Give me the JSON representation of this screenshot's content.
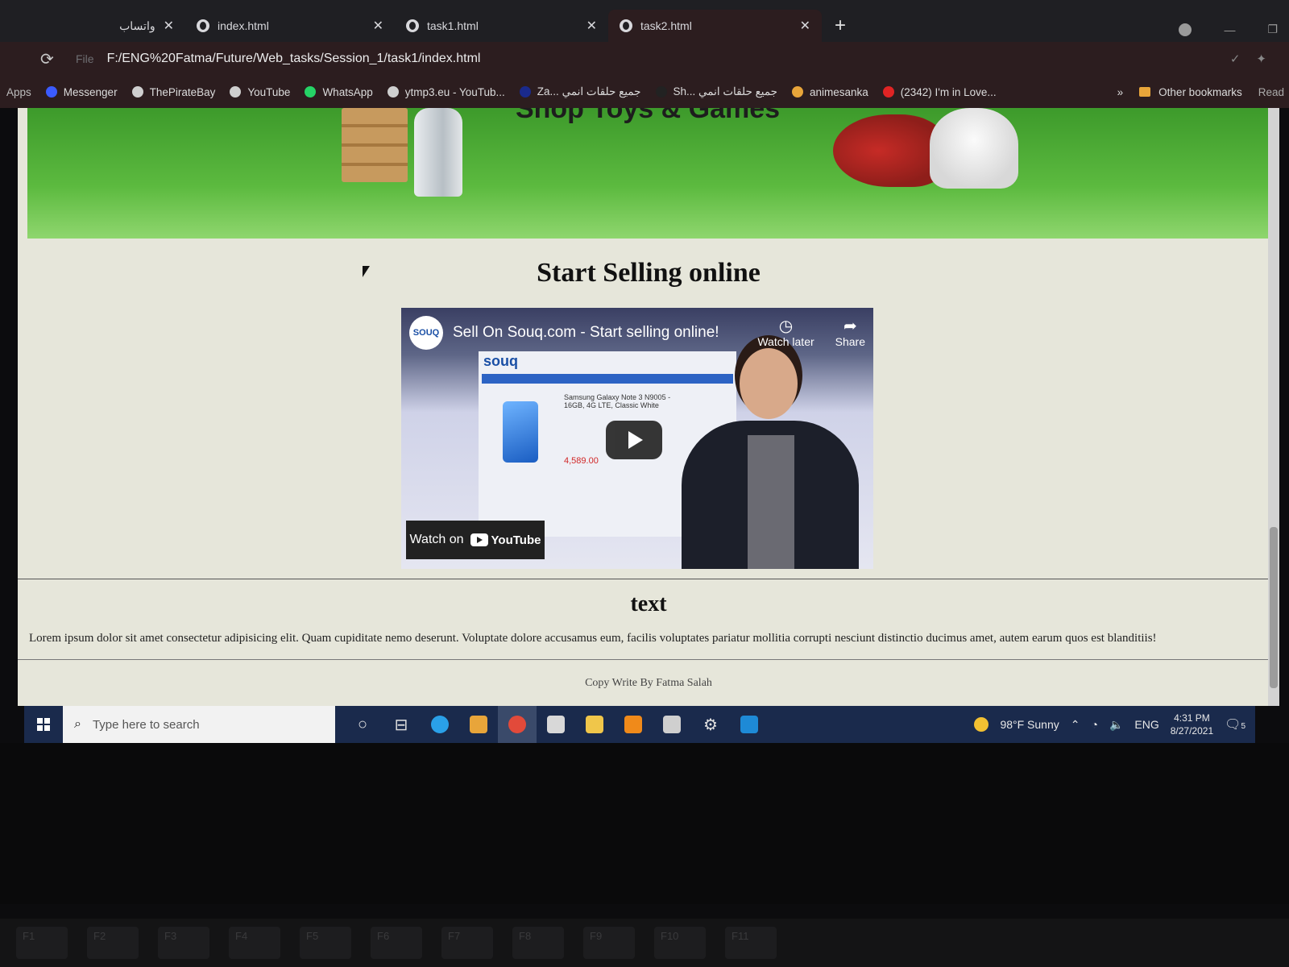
{
  "browser": {
    "tabs": [
      {
        "label": "واتساب",
        "active": false
      },
      {
        "label": "index.html",
        "active": false
      },
      {
        "label": "task1.html",
        "active": false
      },
      {
        "label": "task2.html",
        "active": true
      }
    ],
    "new_tab_label": "+",
    "close_label": "✕",
    "file_chip": "File",
    "url": "F:/ENG%20Fatma/Future/Web_tasks/Session_1/task1/index.html",
    "bookmarks": [
      {
        "label": "Messenger",
        "color": "#3b5bff"
      },
      {
        "label": "ThePirateBay",
        "color": "#cfcfcf"
      },
      {
        "label": "YouTube",
        "color": "#cfcfcf"
      },
      {
        "label": "WhatsApp",
        "color": "#25d366"
      },
      {
        "label": "ytmp3.eu - YouTub...",
        "color": "#cfcfcf"
      },
      {
        "label": "Za... جميع حلقات انمي",
        "color": "#1a2a8c"
      },
      {
        "label": "Sh... جميع حلقات انمي",
        "color": "#222222"
      },
      {
        "label": "animesanka",
        "color": "#e8a53a"
      },
      {
        "label": "(2342) I'm in Love...",
        "color": "#e02424"
      }
    ],
    "apps_label": "Apps",
    "more_label": "»",
    "other_bookmarks": "Other bookmarks",
    "reading_list": "Read"
  },
  "page": {
    "hero_title": "Shop Toys & Games",
    "section_title": "Start Selling online",
    "video": {
      "logo_text": "SOUQ",
      "title": "Sell On Souq.com - Start selling online!",
      "watch_later": "Watch later",
      "share": "Share",
      "mock_brand": "souq",
      "mock_product": "Samsung Galaxy Note 3 N9005 - 16GB, 4G LTE, Classic White",
      "mock_price": "4,589.00",
      "watch_on": "Watch on",
      "youtube": "YouTube"
    },
    "text_heading": "text",
    "paragraph": "Lorem ipsum dolor sit amet consectetur adipisicing elit. Quam cupiditate nemo deserunt. Voluptate dolore accusamus eum, facilis voluptates pariatur mollitia corrupti nesciunt distinctio ducimus amet, autem earum quos est blanditiis!",
    "copyright": "Copy Write By Fatma Salah"
  },
  "taskbar": {
    "search_placeholder": "Type here to search",
    "weather": "98°F  Sunny",
    "language": "ENG",
    "time": "4:31 PM",
    "date": "8/27/2021",
    "notifications": "5"
  },
  "keyboard": {
    "fkeys": [
      "F1",
      "F2",
      "F3",
      "F4",
      "F5",
      "F6",
      "F7",
      "F8",
      "F9",
      "F10",
      "F11"
    ]
  }
}
